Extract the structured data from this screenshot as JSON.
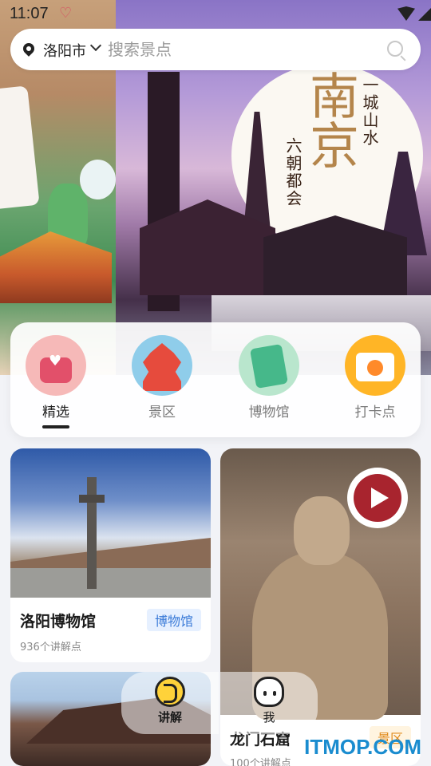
{
  "status_bar": {
    "time": "11:07"
  },
  "search": {
    "city": "洛阳市",
    "placeholder": "搜索景点"
  },
  "banner": {
    "big_text": "南京",
    "slogan_1": "一城山水",
    "slogan_2": "六朝都会"
  },
  "categories": [
    {
      "label": "精选",
      "icon": "heart-bag-icon",
      "active": true
    },
    {
      "label": "景区",
      "icon": "pagoda-icon",
      "active": false
    },
    {
      "label": "博物馆",
      "icon": "museum-artifact-icon",
      "active": false
    },
    {
      "label": "打卡点",
      "icon": "camera-icon",
      "active": false
    }
  ],
  "cards": [
    {
      "title": "洛阳博物馆",
      "tag": "博物馆",
      "subtitle": "936个讲解点"
    },
    {
      "title": "龙门石窟",
      "tag": "景区",
      "subtitle": "100个讲解点"
    },
    {
      "title": "",
      "tag": "",
      "subtitle": ""
    }
  ],
  "floating_nav": {
    "audio_label": "讲解",
    "me_label": "我"
  },
  "watermark": {
    "text": "ITMOP.COM"
  },
  "colors": {
    "accent_blue": "#3b7bd8",
    "accent_orange": "#e08a1a",
    "play_red": "#a8242e"
  }
}
